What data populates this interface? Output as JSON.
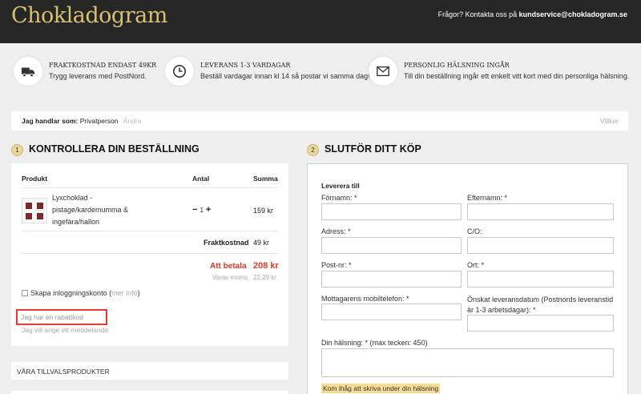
{
  "brand": {
    "logo": "Chokladogram"
  },
  "header": {
    "contact_prefix": "Frågor? Kontakta oss på",
    "contact_email": "kundservice@chokladogram.se"
  },
  "benefits": [
    {
      "icon": "truck-icon",
      "title": "Fraktkostnad endast 49kr",
      "text": "Trygg leverans med PostNord."
    },
    {
      "icon": "clock-icon",
      "title": "Leverans 1-3 vardagar",
      "text": "Beställ vardagar innan kl 14 så postar vi samma dag!"
    },
    {
      "icon": "envelope-icon",
      "title": "Personlig hälsning ingår",
      "text": "Till din beställning ingår ett enkelt vitt kort med din personliga hälsning."
    }
  ],
  "shopper": {
    "label": "Jag handlar som:",
    "value": "Privatperson",
    "change": "Ändra",
    "terms": "Villkor"
  },
  "step1": {
    "number": "1",
    "title": "KONTROLLERA DIN BESTÄLLNING"
  },
  "step2": {
    "number": "2",
    "title": "SLUTFÖR DITT KÖP"
  },
  "order": {
    "headers": {
      "product": "Produkt",
      "quantity": "Antal",
      "sum": "Summa"
    },
    "item": {
      "name": "Lyxchoklad - pistage/kardemumma & ingefära/hallon",
      "minus": "−",
      "quantity": "1",
      "plus": "+",
      "price": "159 kr"
    },
    "shipping_label": "Fraktkostnad",
    "shipping_value": "49 kr",
    "pay_label": "Att betala",
    "pay_value": "208 kr",
    "vat_label": "Varav moms",
    "vat_value": "22,29 kr",
    "create_account": "Skapa inloggningskonto (",
    "more_info": "mer info",
    "create_close": ")",
    "coupon": "Jag har en rabattkod",
    "message": "Jag vill ange ett meddelande"
  },
  "addons": {
    "title": "Våra tillvalsprodukter"
  },
  "checkout": {
    "deliver_to": "Leverera till",
    "firstname": "Förnamn: *",
    "lastname": "Efternamn: *",
    "address": "Adress: *",
    "co": "C/O:",
    "zip": "Post-nr: *",
    "city": "Ort: *",
    "phone": "Mottagarens mobiltelefon: *",
    "date": "Önskat leveransdatum (Postnords leveranstid är 1-3 arbetsdagar): *",
    "greeting": "Din hälsning: * (max tecken: 450)",
    "note": "Kom ihåg att skriva under din hälsning"
  }
}
